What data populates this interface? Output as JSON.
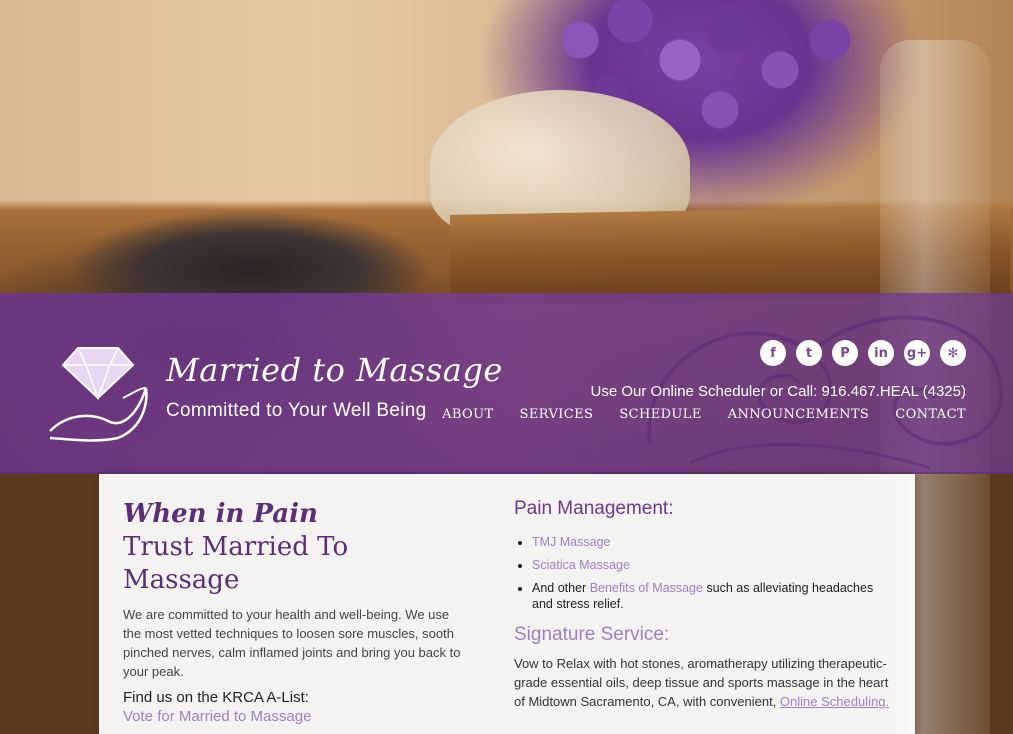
{
  "brand": {
    "title": "Married to Massage",
    "tagline": "Committed to Your Well Being"
  },
  "header": {
    "socials": [
      {
        "icon": "facebook-icon",
        "glyph": "f"
      },
      {
        "icon": "twitter-icon",
        "glyph": "t"
      },
      {
        "icon": "pinterest-icon",
        "glyph": "P"
      },
      {
        "icon": "linkedin-icon",
        "glyph": "in"
      },
      {
        "icon": "google-plus-icon",
        "glyph": "g+"
      },
      {
        "icon": "yelp-icon",
        "glyph": "✻"
      }
    ],
    "call_line": "Use Our Online Scheduler or Call: 916.467.HEAL (4325)",
    "nav": [
      "ABOUT",
      "SERVICES",
      "SCHEDULE",
      "ANNOUNCEMENTS",
      "CONTACT"
    ]
  },
  "left": {
    "heading_pain": "When in Pain",
    "heading_trust": "Trust Married To Massage",
    "intro": "We are committed to your health and well-being. We use the most vetted techniques to loosen sore muscles, sooth pinched nerves, calm inflamed joints and bring you back to your peak.",
    "krca": "Find us on the KRCA A-List:",
    "vote": "Vote for Married to Massage"
  },
  "right": {
    "pain_heading": "Pain Management:",
    "item1": "TMJ Massage",
    "item2": "Sciatica Massage",
    "item3_pre": "And other ",
    "item3_link": "Benefits of Massage",
    "item3_post": " such as alleviating headaches and stress relief.",
    "sig_heading": "Signature Service:",
    "sig_text": "Vow to Relax with hot stones, aromatherapy utilizing therapeutic-grade essential oils, deep tissue and sports massage in the heart of Midtown Sacramento, CA, with convenient, ",
    "sig_link": "Online Scheduling."
  },
  "colors": {
    "band": "#7a3e9a",
    "accent": "#a07fc4",
    "heading": "#5a2f78"
  }
}
